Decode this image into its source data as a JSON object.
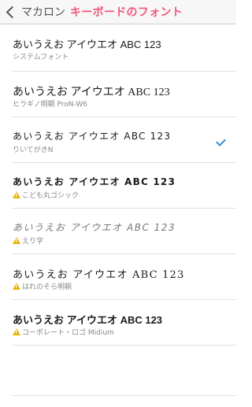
{
  "navbar": {
    "back_label": "マカロン",
    "title": "キーボードのフォント"
  },
  "fonts": [
    {
      "sample": "あいうえお アイウエオ ABC 123",
      "name": "システムフォント",
      "selected": false,
      "warning": false
    },
    {
      "sample": "あいうえお アイウエオ ABC 123",
      "name": "ヒラギノ明朝 ProN-W6",
      "selected": false,
      "warning": false
    },
    {
      "sample": "あいうえお アイウエオ ABC 123",
      "name": "りいてがきN",
      "selected": true,
      "warning": false
    },
    {
      "sample": "あいうえお アイウエオ ABC 123",
      "name": "こども丸ゴシック",
      "selected": false,
      "warning": true
    },
    {
      "sample": "あいうえお アイウエオ ABC 123",
      "name": "えり字",
      "selected": false,
      "warning": true
    },
    {
      "sample": "あいうえお アイウエオ ABC 123",
      "name": "はれのそら明朝",
      "selected": false,
      "warning": true
    },
    {
      "sample": "あいうえお アイウエオ ABC 123",
      "name": "コーポレート・ロゴ Midium",
      "selected": false,
      "warning": true
    }
  ],
  "colors": {
    "accent": "#f0577c",
    "check": "#2f8fe0",
    "warning": "#e8b300"
  },
  "icons": {
    "back": "chevron-left-icon",
    "selected": "checkmark-icon",
    "warning": "warning-triangle-icon"
  }
}
